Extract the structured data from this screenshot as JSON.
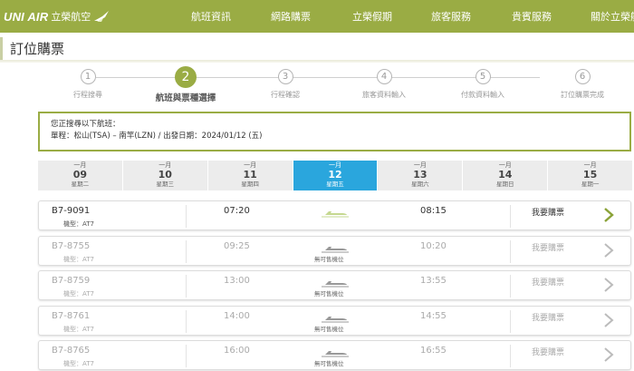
{
  "header": {
    "logo_en": "UNI AIR",
    "logo_zh": "立榮航空",
    "nav": [
      "航班資訊",
      "網路購票",
      "立榮假期",
      "旅客服務",
      "貴賓服務",
      "關於立榮航"
    ]
  },
  "page_title": "訂位購票",
  "steps": [
    {
      "num": "1",
      "label": "行程搜尋"
    },
    {
      "num": "2",
      "label": "航班與票種選擇"
    },
    {
      "num": "3",
      "label": "行程確認"
    },
    {
      "num": "4",
      "label": "旅客資料輸入"
    },
    {
      "num": "5",
      "label": "付款資料輸入"
    },
    {
      "num": "6",
      "label": "訂位購票完成"
    }
  ],
  "active_step": 2,
  "search_info": {
    "heading": "您正搜尋以下航班：",
    "route": "單程：松山(TSA) – 南竿(LZN)  /  出發日期：2024/01/12 (五)"
  },
  "dates": [
    {
      "month": "一月",
      "day": "09",
      "weekday": "星期二"
    },
    {
      "month": "一月",
      "day": "10",
      "weekday": "星期三"
    },
    {
      "month": "一月",
      "day": "11",
      "weekday": "星期四"
    },
    {
      "month": "一月",
      "day": "12",
      "weekday": "星期五"
    },
    {
      "month": "一月",
      "day": "13",
      "weekday": "星期六"
    },
    {
      "month": "一月",
      "day": "14",
      "weekday": "星期日"
    },
    {
      "month": "一月",
      "day": "15",
      "weekday": "星期一"
    }
  ],
  "selected_date_index": 3,
  "flights": [
    {
      "number": "B7-9091",
      "aircraft": "機型：AT7",
      "depart": "07:20",
      "arrive": "08:15",
      "status": "",
      "buy": "我要購票",
      "available": true
    },
    {
      "number": "B7-8755",
      "aircraft": "機型：AT7",
      "depart": "09:25",
      "arrive": "10:20",
      "status": "無可售機位",
      "buy": "我要購票",
      "available": false
    },
    {
      "number": "B7-8759",
      "aircraft": "機型：AT7",
      "depart": "13:00",
      "arrive": "13:55",
      "status": "無可售機位",
      "buy": "我要購票",
      "available": false
    },
    {
      "number": "B7-8761",
      "aircraft": "機型：AT7",
      "depart": "14:00",
      "arrive": "14:55",
      "status": "無可售機位",
      "buy": "我要購票",
      "available": false
    },
    {
      "number": "B7-8765",
      "aircraft": "機型：AT7",
      "depart": "16:00",
      "arrive": "16:55",
      "status": "無可售機位",
      "buy": "我要購票",
      "available": false
    }
  ],
  "colors": {
    "brand_green": "#9aac44",
    "selected_date_blue": "#2aa6dd",
    "available_chevron": "#8aa237",
    "unavailable_chevron": "#bbbbbb",
    "available_plane": "#c5d890",
    "unavailable_plane": "#999999"
  }
}
